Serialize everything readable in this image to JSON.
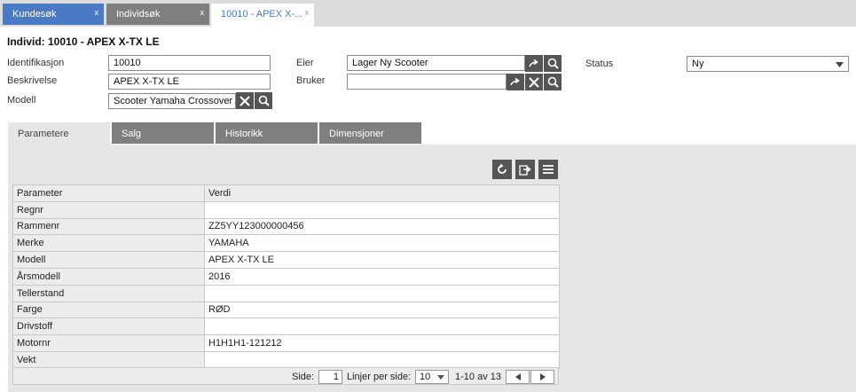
{
  "top_tabs": [
    {
      "label": "Kundesøk",
      "close": "x"
    },
    {
      "label": "Individsøk",
      "close": "x"
    },
    {
      "label": "10010 - APEX X-...",
      "close": "x"
    }
  ],
  "page_title": "Individ: 10010 - APEX X-TX LE",
  "form": {
    "identifikasjon_label": "Identifikasjon",
    "identifikasjon_value": "10010",
    "beskrivelse_label": "Beskrivelse",
    "beskrivelse_value": "APEX X-TX LE",
    "modell_label": "Modell",
    "modell_value": "Scooter Yamaha Crossover A",
    "eier_label": "Eier",
    "eier_value": "Lager Ny Scooter",
    "bruker_label": "Bruker",
    "bruker_value": "",
    "status_label": "Status",
    "status_value": "Ny"
  },
  "sub_tabs": [
    "Parametere",
    "Salg",
    "Historikk",
    "Dimensjoner"
  ],
  "table": {
    "headers": [
      "Parameter",
      "Verdi"
    ],
    "rows": [
      [
        "Regnr",
        ""
      ],
      [
        "Rammenr",
        "ZZ5YY123000000456"
      ],
      [
        "Merke",
        "YAMAHA"
      ],
      [
        "Modell",
        "APEX X-TX LE"
      ],
      [
        "Årsmodell",
        "2016"
      ],
      [
        "Tellerstand",
        ""
      ],
      [
        "Farge",
        "RØD"
      ],
      [
        "Drivstoff",
        ""
      ],
      [
        "Motornr",
        "H1H1H1-121212"
      ],
      [
        "Vekt",
        ""
      ]
    ]
  },
  "pager": {
    "side_label": "Side:",
    "page": "1",
    "per_page_label": "Linjer per side:",
    "per_page": "10",
    "range": "1-10 av 13"
  }
}
